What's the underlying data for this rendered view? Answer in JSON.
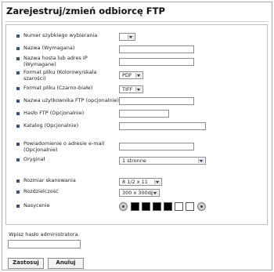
{
  "page": {
    "title": "Zarejestruj/zmień odbiorcę FTP"
  },
  "form": {
    "quick_dial_label": "Numer szybkiego wybierania",
    "name_label": "Nazwa (Wymagana)",
    "host_label": "Nazwa hosta lub adres IP (Wymagane)",
    "file_format_color_label": "Format pliku (Kolorowy/skala szarości)",
    "file_format_color_value": "PDF",
    "file_format_bw_label": "Format pliku (Czarno-białe)",
    "file_format_bw_value": "TIFF",
    "ftp_user_label": "Nazwa użytkownika FTP (opcjonalnie)",
    "ftp_password_label": "Hasło FTP (Opcjonalnie)",
    "directory_label": "Katalog (Opcjonalnie)",
    "email_notice_label": "Powiadomienie o adresie e-mail (Opcjonalnie)",
    "original_label": "Oryginał",
    "original_value": "1 stronne",
    "scan_size_label": "Rozmiar skanowania",
    "scan_size_value": "8 1/2 x 11",
    "resolution_label": "Rozdzielczość",
    "resolution_value": "300 x 300dpi",
    "saturation_label": "Nasycenie"
  },
  "admin": {
    "prompt": "Wpisz hasło administratora."
  },
  "buttons": {
    "apply": "Zastosuj",
    "cancel": "Anuluj"
  },
  "colors": {
    "bullet": "#3a4f79",
    "frame_border": "#a9a9a9"
  },
  "saturation_levels": [
    "dark",
    "dark",
    "dark",
    "dark",
    "light",
    "light"
  ],
  "saturation_selected_index": 0
}
